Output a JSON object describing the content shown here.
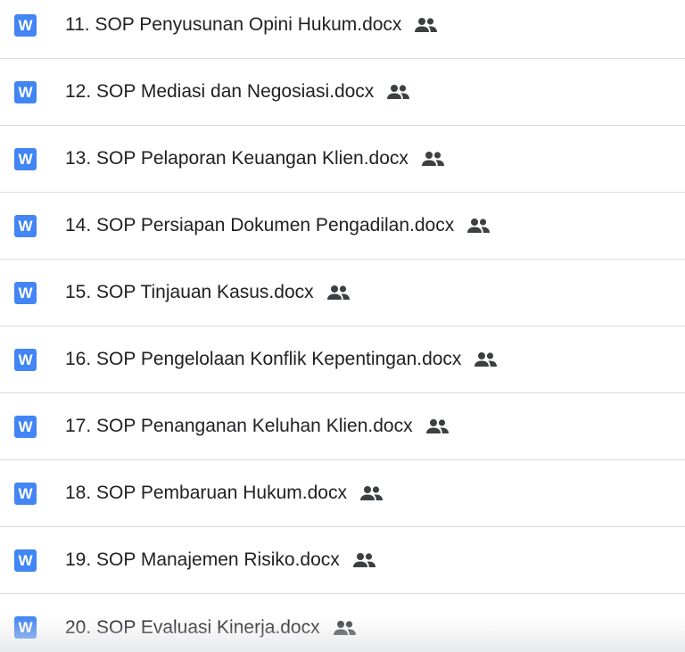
{
  "colors": {
    "word_icon_bg": "#4285f4",
    "shared_icon": "#3c4043",
    "text": "#202124",
    "divider": "#dadce0"
  },
  "word_icon_letter": "W",
  "files": [
    {
      "name": "11. SOP Penyusunan Opini Hukum.docx",
      "type_icon": "word-icon",
      "shared": true
    },
    {
      "name": "12. SOP Mediasi dan Negosiasi.docx",
      "type_icon": "word-icon",
      "shared": true
    },
    {
      "name": "13. SOP Pelaporan Keuangan Klien.docx",
      "type_icon": "word-icon",
      "shared": true
    },
    {
      "name": "14. SOP Persiapan Dokumen Pengadilan.docx",
      "type_icon": "word-icon",
      "shared": true
    },
    {
      "name": "15. SOP Tinjauan Kasus.docx",
      "type_icon": "word-icon",
      "shared": true
    },
    {
      "name": "16. SOP Pengelolaan Konflik Kepentingan.docx",
      "type_icon": "word-icon",
      "shared": true
    },
    {
      "name": "17. SOP Penanganan Keluhan Klien.docx",
      "type_icon": "word-icon",
      "shared": true
    },
    {
      "name": "18. SOP Pembaruan Hukum.docx",
      "type_icon": "word-icon",
      "shared": true
    },
    {
      "name": "19. SOP Manajemen Risiko.docx",
      "type_icon": "word-icon",
      "shared": true
    },
    {
      "name": "20. SOP Evaluasi Kinerja.docx",
      "type_icon": "word-icon",
      "shared": true
    }
  ]
}
